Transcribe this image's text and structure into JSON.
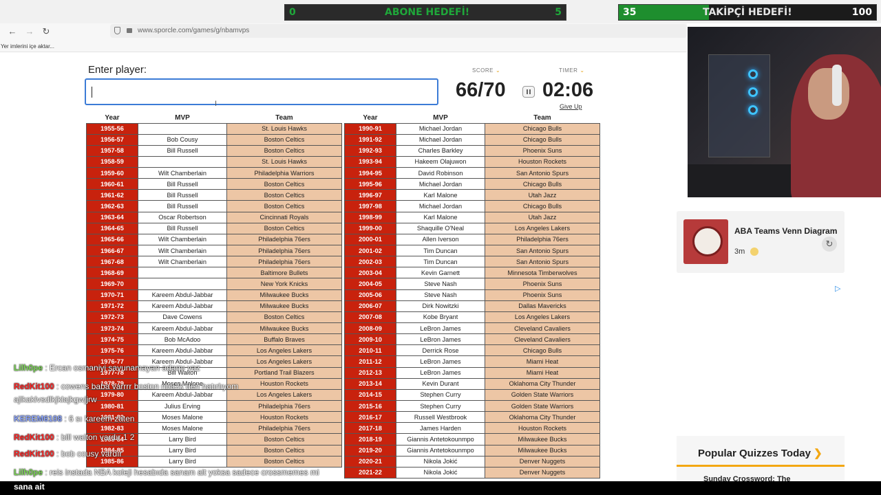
{
  "stream": {
    "sub_goal": {
      "label": "ABONE HEDEFİ!",
      "current": "0",
      "target": "5",
      "progress": 0.0
    },
    "follower_goal": {
      "label": "TAKİPÇİ HEDEFİ!",
      "current": "35",
      "target": "100",
      "progress": 0.35
    }
  },
  "browser": {
    "url": "www.sporcle.com/games/g/nbamvps",
    "bookmarks_import": "Yer imlerini içe aktar..."
  },
  "quiz": {
    "enter_label": "Enter player:",
    "score_label": "SCORE",
    "timer_label": "TIMER",
    "score": "66/70",
    "timer": "02:06",
    "give_up": "Give Up",
    "headers": {
      "year": "Year",
      "mvp": "MVP",
      "team": "Team"
    },
    "left_rows": [
      {
        "year": "1955-56",
        "mvp": "",
        "team": "St. Louis Hawks"
      },
      {
        "year": "1956-57",
        "mvp": "Bob Cousy",
        "team": "Boston Celtics"
      },
      {
        "year": "1957-58",
        "mvp": "Bill Russell",
        "team": "Boston Celtics"
      },
      {
        "year": "1958-59",
        "mvp": "",
        "team": "St. Louis Hawks"
      },
      {
        "year": "1959-60",
        "mvp": "Wilt Chamberlain",
        "team": "Philadelphia Warriors"
      },
      {
        "year": "1960-61",
        "mvp": "Bill Russell",
        "team": "Boston Celtics"
      },
      {
        "year": "1961-62",
        "mvp": "Bill Russell",
        "team": "Boston Celtics"
      },
      {
        "year": "1962-63",
        "mvp": "Bill Russell",
        "team": "Boston Celtics"
      },
      {
        "year": "1963-64",
        "mvp": "Oscar Robertson",
        "team": "Cincinnati Royals"
      },
      {
        "year": "1964-65",
        "mvp": "Bill Russell",
        "team": "Boston Celtics"
      },
      {
        "year": "1965-66",
        "mvp": "Wilt Chamberlain",
        "team": "Philadelphia 76ers"
      },
      {
        "year": "1966-67",
        "mvp": "Wilt Chamberlain",
        "team": "Philadelphia 76ers"
      },
      {
        "year": "1967-68",
        "mvp": "Wilt Chamberlain",
        "team": "Philadelphia 76ers"
      },
      {
        "year": "1968-69",
        "mvp": "",
        "team": "Baltimore Bullets"
      },
      {
        "year": "1969-70",
        "mvp": "",
        "team": "New York Knicks"
      },
      {
        "year": "1970-71",
        "mvp": "Kareem Abdul-Jabbar",
        "team": "Milwaukee Bucks"
      },
      {
        "year": "1971-72",
        "mvp": "Kareem Abdul-Jabbar",
        "team": "Milwaukee Bucks"
      },
      {
        "year": "1972-73",
        "mvp": "Dave Cowens",
        "team": "Boston Celtics"
      },
      {
        "year": "1973-74",
        "mvp": "Kareem Abdul-Jabbar",
        "team": "Milwaukee Bucks"
      },
      {
        "year": "1974-75",
        "mvp": "Bob McAdoo",
        "team": "Buffalo Braves"
      },
      {
        "year": "1975-76",
        "mvp": "Kareem Abdul-Jabbar",
        "team": "Los Angeles Lakers"
      },
      {
        "year": "1976-77",
        "mvp": "Kareem Abdul-Jabbar",
        "team": "Los Angeles Lakers"
      },
      {
        "year": "1977-78",
        "mvp": "Bill Walton",
        "team": "Portland Trail Blazers"
      },
      {
        "year": "1978-79",
        "mvp": "Moses Malone",
        "team": "Houston Rockets"
      },
      {
        "year": "1979-80",
        "mvp": "Kareem Abdul-Jabbar",
        "team": "Los Angeles Lakers"
      },
      {
        "year": "1980-81",
        "mvp": "Julius Erving",
        "team": "Philadelphia 76ers"
      },
      {
        "year": "1981-82",
        "mvp": "Moses Malone",
        "team": "Houston Rockets"
      },
      {
        "year": "1982-83",
        "mvp": "Moses Malone",
        "team": "Philadelphia 76ers"
      },
      {
        "year": "1983-84",
        "mvp": "Larry Bird",
        "team": "Boston Celtics"
      },
      {
        "year": "1984-85",
        "mvp": "Larry Bird",
        "team": "Boston Celtics"
      },
      {
        "year": "1985-86",
        "mvp": "Larry Bird",
        "team": "Boston Celtics"
      }
    ],
    "right_rows": [
      {
        "year": "1990-91",
        "mvp": "Michael Jordan",
        "team": "Chicago Bulls"
      },
      {
        "year": "1991-92",
        "mvp": "Michael Jordan",
        "team": "Chicago Bulls"
      },
      {
        "year": "1992-93",
        "mvp": "Charles Barkley",
        "team": "Phoenix Suns"
      },
      {
        "year": "1993-94",
        "mvp": "Hakeem Olajuwon",
        "team": "Houston Rockets"
      },
      {
        "year": "1994-95",
        "mvp": "David Robinson",
        "team": "San Antonio Spurs"
      },
      {
        "year": "1995-96",
        "mvp": "Michael Jordan",
        "team": "Chicago Bulls"
      },
      {
        "year": "1996-97",
        "mvp": "Karl Malone",
        "team": "Utah Jazz"
      },
      {
        "year": "1997-98",
        "mvp": "Michael Jordan",
        "team": "Chicago Bulls"
      },
      {
        "year": "1998-99",
        "mvp": "Karl Malone",
        "team": "Utah Jazz"
      },
      {
        "year": "1999-00",
        "mvp": "Shaquille O'Neal",
        "team": "Los Angeles Lakers"
      },
      {
        "year": "2000-01",
        "mvp": "Allen Iverson",
        "team": "Philadelphia 76ers"
      },
      {
        "year": "2001-02",
        "mvp": "Tim Duncan",
        "team": "San Antonio Spurs"
      },
      {
        "year": "2002-03",
        "mvp": "Tim Duncan",
        "team": "San Antonio Spurs"
      },
      {
        "year": "2003-04",
        "mvp": "Kevin Garnett",
        "team": "Minnesota Timberwolves"
      },
      {
        "year": "2004-05",
        "mvp": "Steve Nash",
        "team": "Phoenix Suns"
      },
      {
        "year": "2005-06",
        "mvp": "Steve Nash",
        "team": "Phoenix Suns"
      },
      {
        "year": "2006-07",
        "mvp": "Dirk Nowitzki",
        "team": "Dallas Mavericks"
      },
      {
        "year": "2007-08",
        "mvp": "Kobe Bryant",
        "team": "Los Angeles Lakers"
      },
      {
        "year": "2008-09",
        "mvp": "LeBron James",
        "team": "Cleveland Cavaliers"
      },
      {
        "year": "2009-10",
        "mvp": "LeBron James",
        "team": "Cleveland Cavaliers"
      },
      {
        "year": "2010-11",
        "mvp": "Derrick Rose",
        "team": "Chicago Bulls"
      },
      {
        "year": "2011-12",
        "mvp": "LeBron James",
        "team": "Miami Heat"
      },
      {
        "year": "2012-13",
        "mvp": "LeBron James",
        "team": "Miami Heat"
      },
      {
        "year": "2013-14",
        "mvp": "Kevin Durant",
        "team": "Oklahoma City Thunder"
      },
      {
        "year": "2014-15",
        "mvp": "Stephen Curry",
        "team": "Golden State Warriors"
      },
      {
        "year": "2015-16",
        "mvp": "Stephen Curry",
        "team": "Golden State Warriors"
      },
      {
        "year": "2016-17",
        "mvp": "Russell Westbrook",
        "team": "Oklahoma City Thunder"
      },
      {
        "year": "2017-18",
        "mvp": "James Harden",
        "team": "Houston Rockets"
      },
      {
        "year": "2018-19",
        "mvp": "Giannis Antetokounmpo",
        "team": "Milwaukee Bucks"
      },
      {
        "year": "2019-20",
        "mvp": "Giannis Antetokounmpo",
        "team": "Milwaukee Bucks"
      },
      {
        "year": "2020-21",
        "mvp": "Nikola Jokić",
        "team": "Denver Nuggets"
      },
      {
        "year": "2021-22",
        "mvp": "Nikola Jokić",
        "team": "Denver Nuggets"
      }
    ]
  },
  "sidebar": {
    "card_title": "ABA Teams Venn Diagram",
    "card_time": "3m",
    "popular_title": "Popular Quizzes Today",
    "popular_arrow": "❯",
    "popular_item": "Sunday Crossword: The"
  },
  "chat": [
    {
      "user": "Lilh0pe",
      "color": "#7ed957",
      "msg": "Ercan osmaniyi savunamayan adamı yaz"
    },
    {
      "user": "RedKit100",
      "color": "#ff2a2a",
      "msg": "cowens baba varrrr boston nba2k den hatırlıyom"
    },
    {
      "user": "",
      "color": "#ffffff",
      "msg": "ajlkaklvsdlkjklajkgwjjrw"
    },
    {
      "user": "KEREM6108",
      "color": "#8fa8ff",
      "msg": "6 sı kareem zaten"
    },
    {
      "user": "RedKit100",
      "color": "#ff2a2a",
      "msg": "bill walton vardır 1 2"
    },
    {
      "user": "RedKit100",
      "color": "#ff2a2a",
      "msg": "bob cousy vardır"
    },
    {
      "user": "Lilh0pe",
      "color": "#7ed957",
      "msg": "reis instada NBA koleji hesabıda sanam ait yoksa sadece crossmemes mi"
    }
  ],
  "chat_tail": "sana ait"
}
